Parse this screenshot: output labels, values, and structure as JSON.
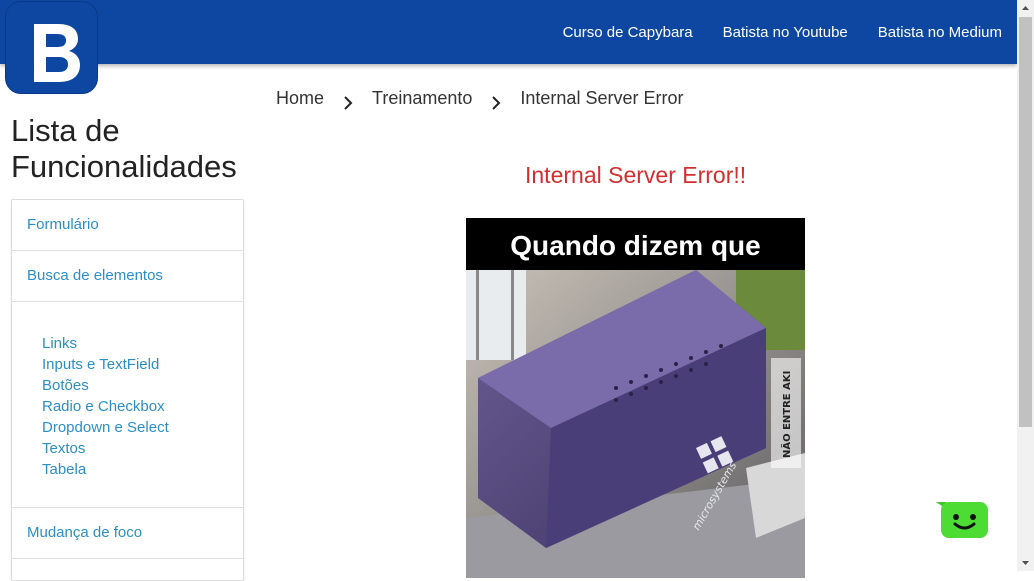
{
  "logo": {
    "letter": "B"
  },
  "nav": {
    "links": [
      "Curso de Capybara",
      "Batista no Youtube",
      "Batista no Medium"
    ]
  },
  "breadcrumb": [
    "Home",
    "Treinamento",
    "Internal Server Error"
  ],
  "sidebar": {
    "title": "Lista de Funcionalidades",
    "items": [
      "Formulário",
      "Busca de elementos",
      "Mudança de foco"
    ],
    "sub_items": [
      "Links",
      "Inputs e TextField",
      "Botões",
      "Radio e Checkbox",
      "Dropdown e Select",
      "Textos",
      "Tabela"
    ]
  },
  "main": {
    "error_title": "Internal Server Error!!",
    "meme": {
      "caption": "Quando dizem que",
      "watermark": "NÃO ENTRE AKI",
      "brand": "microsystems"
    }
  },
  "colors": {
    "navbar": "#0d47a1",
    "link": "#2b8fc7",
    "error": "#d32f2f",
    "chat": "#4cdc34"
  }
}
